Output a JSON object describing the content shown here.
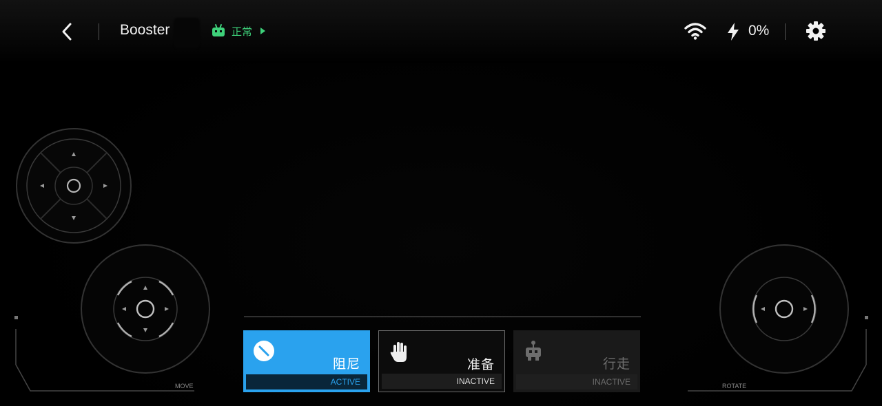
{
  "header": {
    "robot_name": "Booster",
    "status_text": "正常",
    "battery_text": "0%"
  },
  "modes": [
    {
      "name": "阻尼",
      "state": "ACTIVE"
    },
    {
      "name": "准备",
      "state": "INACTIVE"
    },
    {
      "name": "行走",
      "state": "INACTIVE"
    }
  ],
  "controls": {
    "move_label": "MOVE",
    "rotate_label": "ROTATE"
  },
  "colors": {
    "accent": "#2aa2ee",
    "status_green": "#3ed17a",
    "background": "#000000"
  },
  "icons": {
    "back": "chevron-left-icon",
    "status": "robot-icon",
    "wifi": "wifi-icon",
    "battery": "bolt-icon",
    "settings": "gear-icon",
    "mode_damping": "slash-circle-icon",
    "mode_prepare": "hand-icon",
    "mode_walk": "robot-icon"
  }
}
